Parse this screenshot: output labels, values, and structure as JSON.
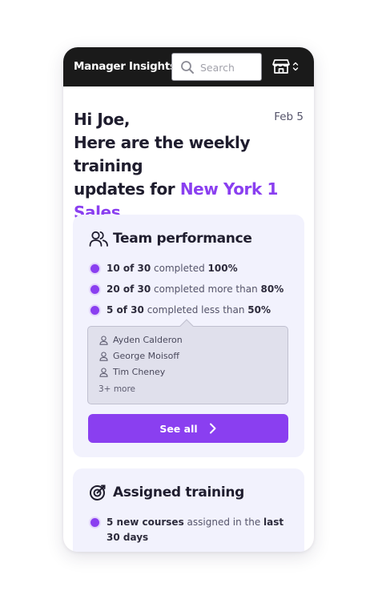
{
  "header": {
    "app_title": "Manager Insights",
    "search_placeholder": "Search",
    "icons": {
      "search": "magnifier-icon",
      "store": "storefront-icon",
      "switch": "chevron-up-down-icon"
    }
  },
  "greeting": {
    "line1": "Hi Joe,",
    "line2": "Here are the weekly training",
    "line3_prefix": "updates for ",
    "line3_accent": "New York 1",
    "line4_accent": "Sales",
    "date": "Feb 5"
  },
  "team_performance": {
    "title": "Team performance",
    "icon": "users-icon",
    "stats": [
      {
        "count": "10 of 30",
        "middle": " completed ",
        "threshold": "100%"
      },
      {
        "count": "20 of 30",
        "middle": " completed more than ",
        "threshold": "80%"
      },
      {
        "count": "5 of 30",
        "middle": " completed less than ",
        "threshold": "50%"
      }
    ],
    "popover": {
      "people": [
        "Ayden Calderon",
        "George Moisoff",
        "Tim Cheney"
      ],
      "more": "3+ more"
    },
    "see_all_label": "See all"
  },
  "assigned_training": {
    "title": "Assigned training",
    "icon": "target-icon",
    "stats": [
      {
        "strong1": "5 new courses",
        "middle": " assigned in the ",
        "strong2": "last 30 days"
      }
    ]
  },
  "colors": {
    "accent": "#8a3ff0",
    "topbar": "#1a1a1a",
    "card_bg": "#f2f2fd",
    "text_dark": "#1f1d2e"
  }
}
